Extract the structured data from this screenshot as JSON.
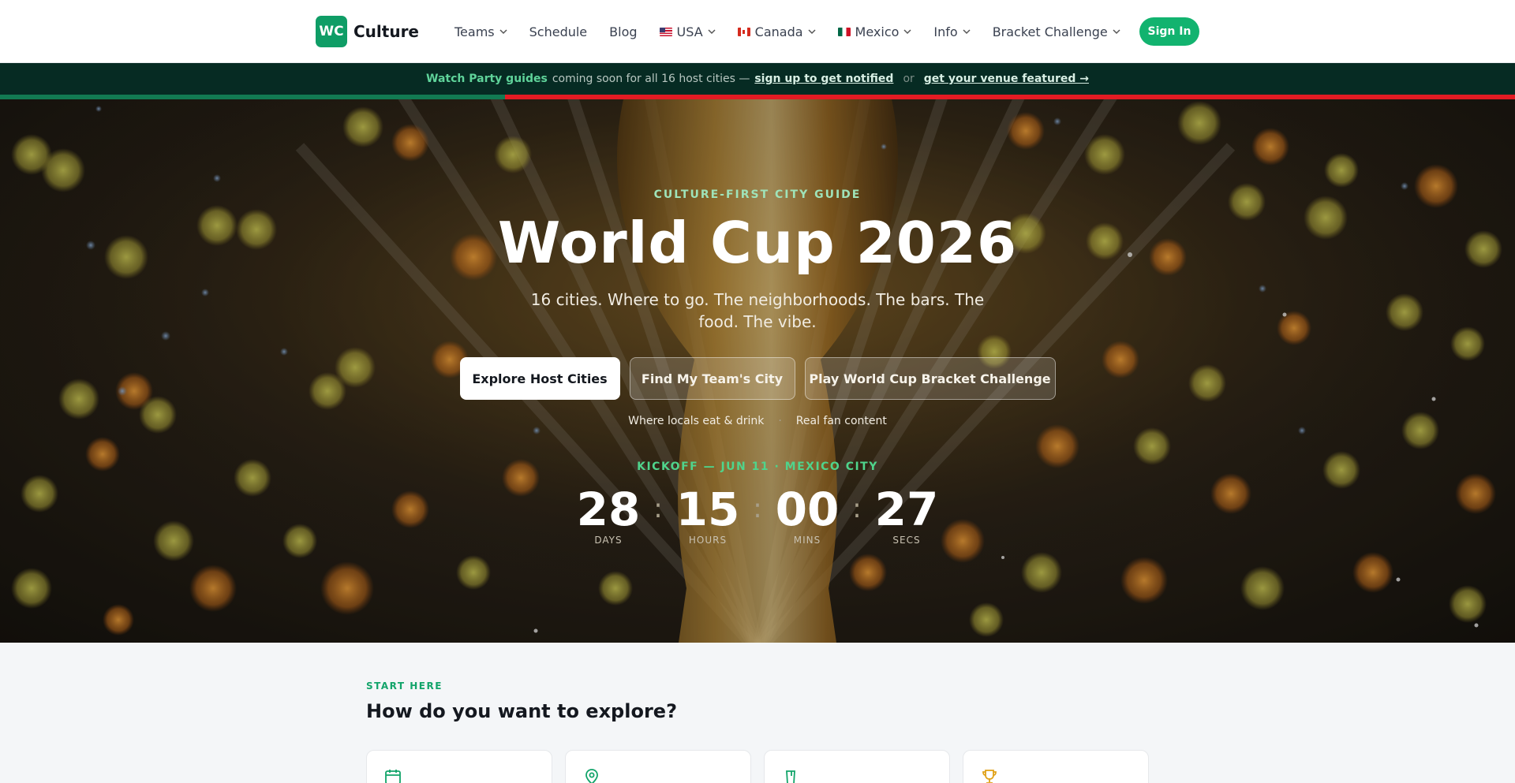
{
  "nav": {
    "logo_badge": "WC",
    "logo_text": "Culture",
    "items": [
      {
        "label": "Teams",
        "dropdown": true
      },
      {
        "label": "Schedule",
        "dropdown": false
      },
      {
        "label": "Blog",
        "dropdown": false
      },
      {
        "label": "USA",
        "dropdown": true,
        "flag": "us"
      },
      {
        "label": "Canada",
        "dropdown": true,
        "flag": "ca"
      },
      {
        "label": "Mexico",
        "dropdown": true,
        "flag": "mx"
      },
      {
        "label": "Info",
        "dropdown": true
      },
      {
        "label": "Bracket Challenge",
        "dropdown": true
      }
    ],
    "sign_in": "Sign In"
  },
  "banner": {
    "highlight": "Watch Party guides",
    "text": "coming soon for all 16 host cities —",
    "link1": "sign up to get notified",
    "or": "or",
    "link2": "get your venue featured →"
  },
  "hero": {
    "eyebrow": "CULTURE-FIRST CITY GUIDE",
    "title": "World Cup 2026",
    "subtitle": "16 cities. Where to go. The neighborhoods. The bars. The food. The vibe.",
    "cta_primary": "Explore Host Cities",
    "cta_secondary": "Find My Team's City",
    "cta_tertiary": "Play World Cup Bracket Challenge",
    "tags": [
      "Where locals eat & drink",
      "Real fan content"
    ],
    "kickoff": "KICKOFF — JUN 11 · MEXICO CITY",
    "countdown": {
      "days": "28",
      "days_label": "DAYS",
      "hours": "15",
      "hours_label": "HOURS",
      "mins": "00",
      "mins_label": "MINS",
      "secs": "27",
      "secs_label": "SECS"
    }
  },
  "explore": {
    "eyebrow": "START HERE",
    "title": "How do you want to explore?",
    "card_icons": [
      "calendar-icon",
      "map-pin-icon",
      "drink-icon",
      "trophy-icon"
    ]
  },
  "colors": {
    "brand": "#12b36f",
    "banner_bg": "#062b23",
    "accent_red": "#e31b23"
  }
}
